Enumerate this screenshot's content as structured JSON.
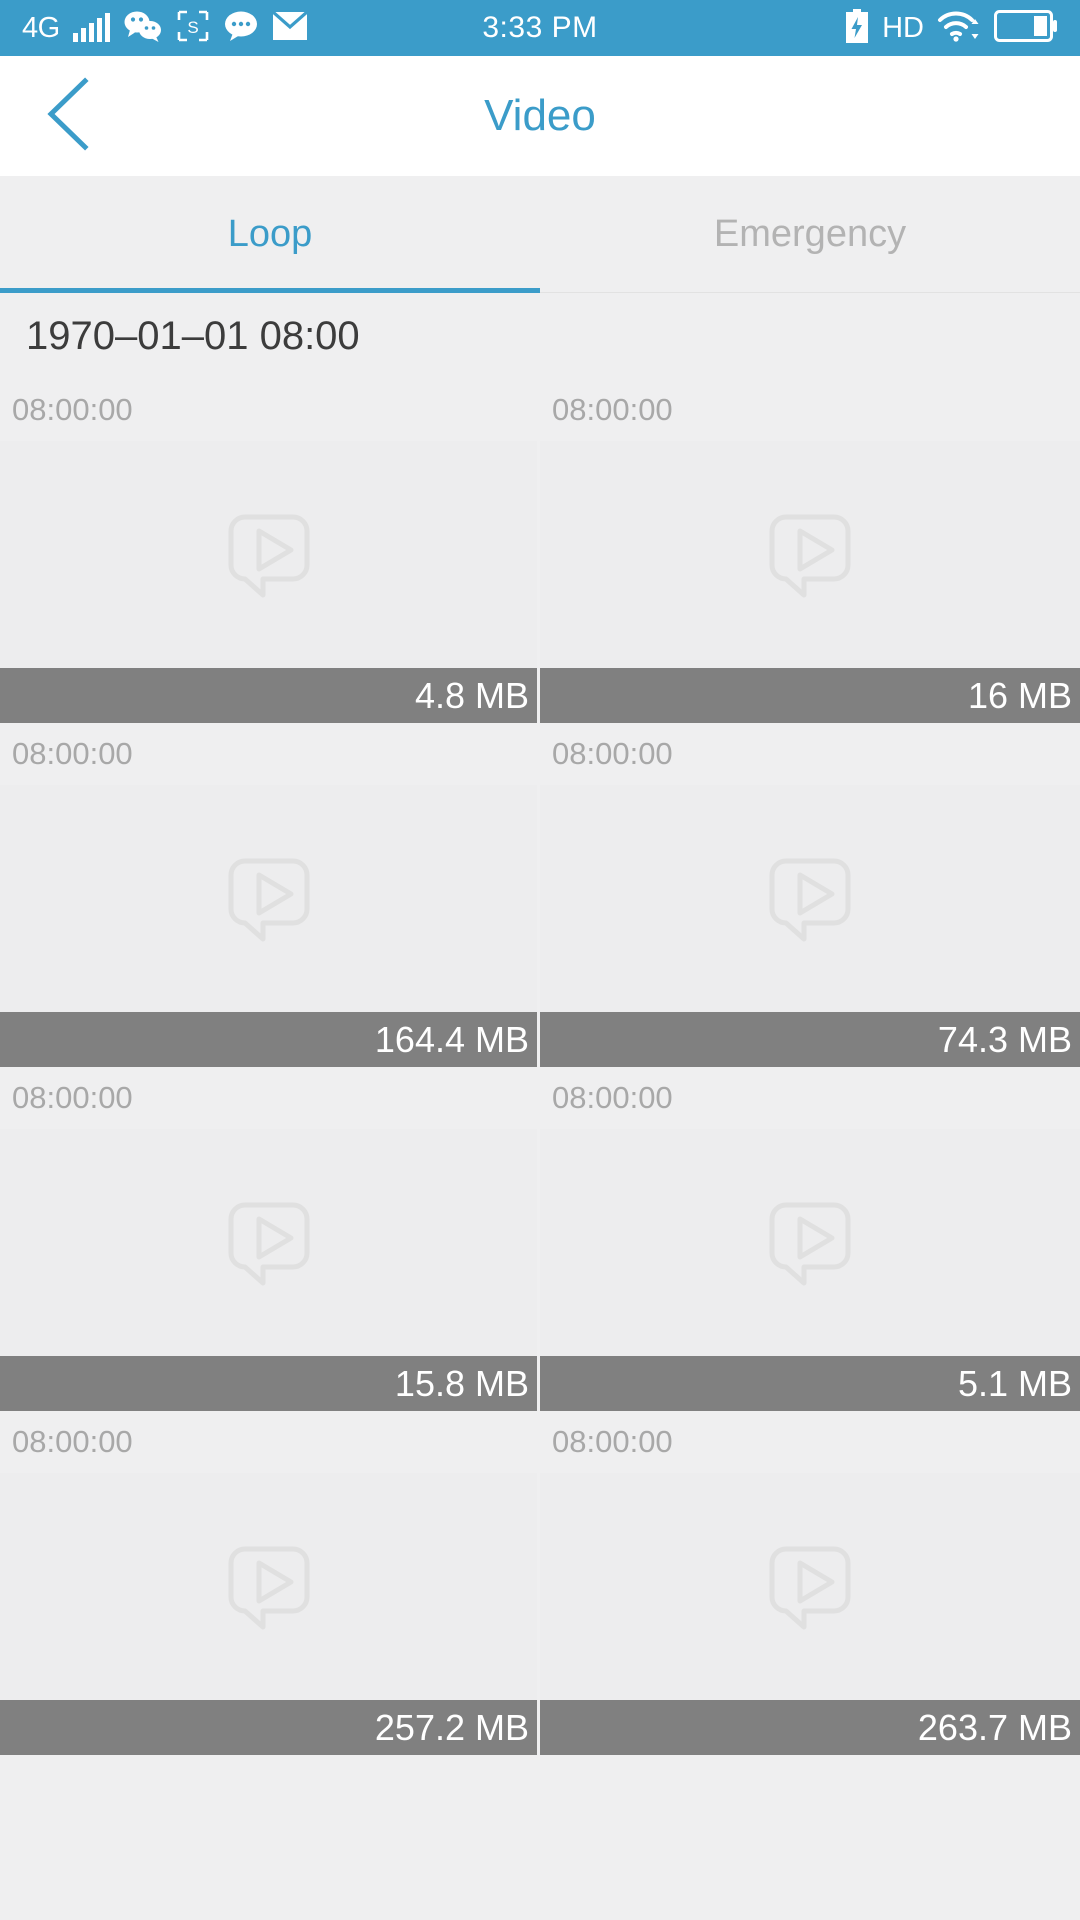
{
  "status_bar": {
    "network_label": "4G",
    "time": "3:33 PM",
    "hd_label": "HD",
    "icons": [
      "signal-bars-icon",
      "wechat-icon",
      "screenshot-s-icon",
      "chat-bubble-icon",
      "envelope-icon",
      "charging-battery-icon",
      "wifi-icon",
      "battery-icon"
    ],
    "background_color": "#3b9cc9"
  },
  "header": {
    "title": "Video",
    "back_icon": "chevron-left-icon",
    "accent_color": "#3b9cc9"
  },
  "tabs": {
    "items": [
      {
        "label": "Loop",
        "active": true
      },
      {
        "label": "Emergency",
        "active": false
      }
    ],
    "active_color": "#3b9cc9",
    "inactive_color": "#b3b3b3"
  },
  "date_group": {
    "label": "1970–01–01 08:00"
  },
  "videos": [
    {
      "time": "08:00:00",
      "size": "4.8 MB"
    },
    {
      "time": "08:00:00",
      "size": "16 MB"
    },
    {
      "time": "08:00:00",
      "size": "164.4 MB"
    },
    {
      "time": "08:00:00",
      "size": "74.3 MB"
    },
    {
      "time": "08:00:00",
      "size": "15.8 MB"
    },
    {
      "time": "08:00:00",
      "size": "5.1 MB"
    },
    {
      "time": "08:00:00",
      "size": "257.2 MB"
    },
    {
      "time": "08:00:00",
      "size": "263.7 MB"
    }
  ],
  "colors": {
    "page_background": "#efeff0",
    "thumbnail_background": "#ededee",
    "size_bar_background": "#808080",
    "timestamp_text": "#a8a8a8"
  }
}
